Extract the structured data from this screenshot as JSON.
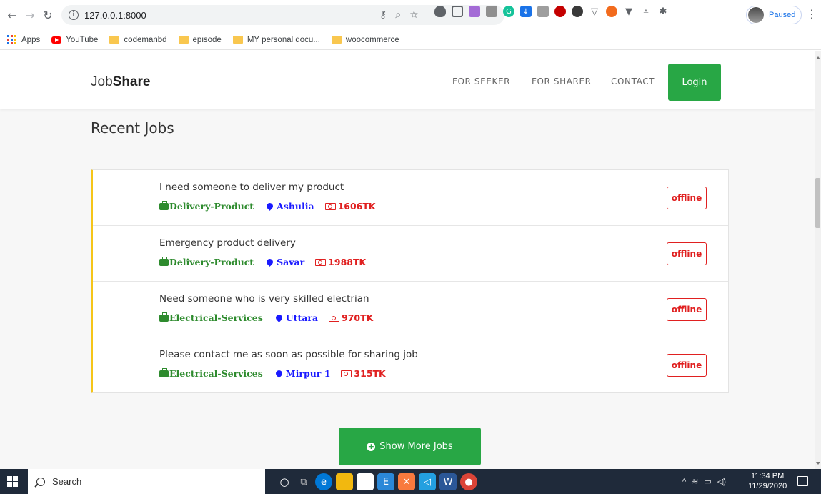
{
  "browser": {
    "url": "127.0.0.1:8000",
    "profile_status": "Paused",
    "extensions": [
      {
        "name": "key-icon",
        "color": "#5f6368"
      },
      {
        "name": "zoom-icon",
        "color": "#5f6368"
      },
      {
        "name": "star-icon",
        "color": "#5f6368"
      }
    ]
  },
  "bookmarks": [
    {
      "label": "Apps",
      "icon": "apps-grid-icon"
    },
    {
      "label": "YouTube",
      "icon": "youtube-icon"
    },
    {
      "label": "codemanbd",
      "icon": "folder-icon"
    },
    {
      "label": "episode",
      "icon": "folder-icon"
    },
    {
      "label": "MY personal docu...",
      "icon": "folder-icon"
    },
    {
      "label": "woocommerce",
      "icon": "folder-icon"
    }
  ],
  "site": {
    "logo_light": "Job",
    "logo_bold": "Share",
    "nav": {
      "seeker": "FOR SEEKER",
      "sharer": "FOR SHARER",
      "contact": "CONTACT",
      "login": "Login"
    },
    "section_title": "Recent Jobs",
    "show_more": "Show More Jobs",
    "accent_color": "#28a745"
  },
  "jobs": [
    {
      "title": "I need someone to deliver my product",
      "category": "Delivery-Product",
      "location": "Ashulia",
      "price": "1606TK",
      "status": "offline"
    },
    {
      "title": "Emergency product delivery",
      "category": "Delivery-Product",
      "location": "Savar",
      "price": "1988TK",
      "status": "offline"
    },
    {
      "title": "Need someone who is very skilled electrian",
      "category": "Electrical-Services",
      "location": "Uttara",
      "price": "970TK",
      "status": "offline"
    },
    {
      "title": "Please contact me as soon as possible for sharing job",
      "category": "Electrical-Services",
      "location": "Mirpur 1",
      "price": "315TK",
      "status": "offline"
    }
  ],
  "taskbar": {
    "search_label": "Search",
    "time": "11:34 PM",
    "date": "11/29/2020"
  }
}
